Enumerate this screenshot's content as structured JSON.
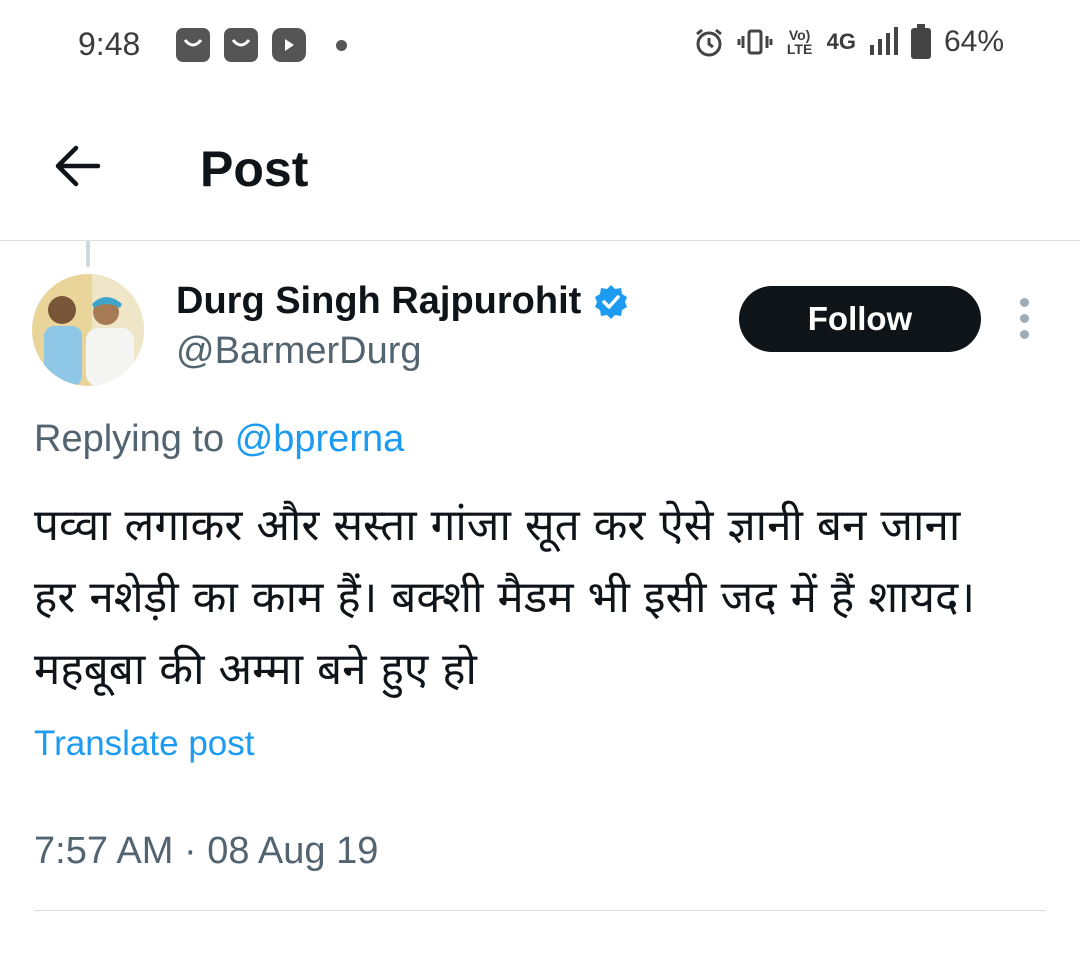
{
  "status_bar": {
    "time": "9:48",
    "battery": "64%",
    "network": "4G",
    "volte": "Vo) LTE"
  },
  "header": {
    "title": "Post"
  },
  "post": {
    "author_name": "Durg Singh Rajpurohit",
    "author_handle": "@BarmerDurg",
    "verified": true,
    "follow_label": "Follow",
    "reply_prefix": "Replying to",
    "reply_handle": "@bprerna",
    "body_lines": [
      "पव्वा लगाकर और सस्ता गांजा सूत कर ऐसे ज्ञानी बन जाना",
      "हर नशेड़ी का काम हैं। बक्शी मैडम भी इसी जद में हैं शायद।",
      "महबूबा की अम्मा बने हुए हो"
    ],
    "translate_label": "Translate post",
    "timestamp": "7:57 AM · 08 Aug 19"
  },
  "colors": {
    "accent": "#1d9bf0",
    "text_primary": "#0f1419",
    "text_secondary": "#536471",
    "button_bg": "#0f1419"
  }
}
